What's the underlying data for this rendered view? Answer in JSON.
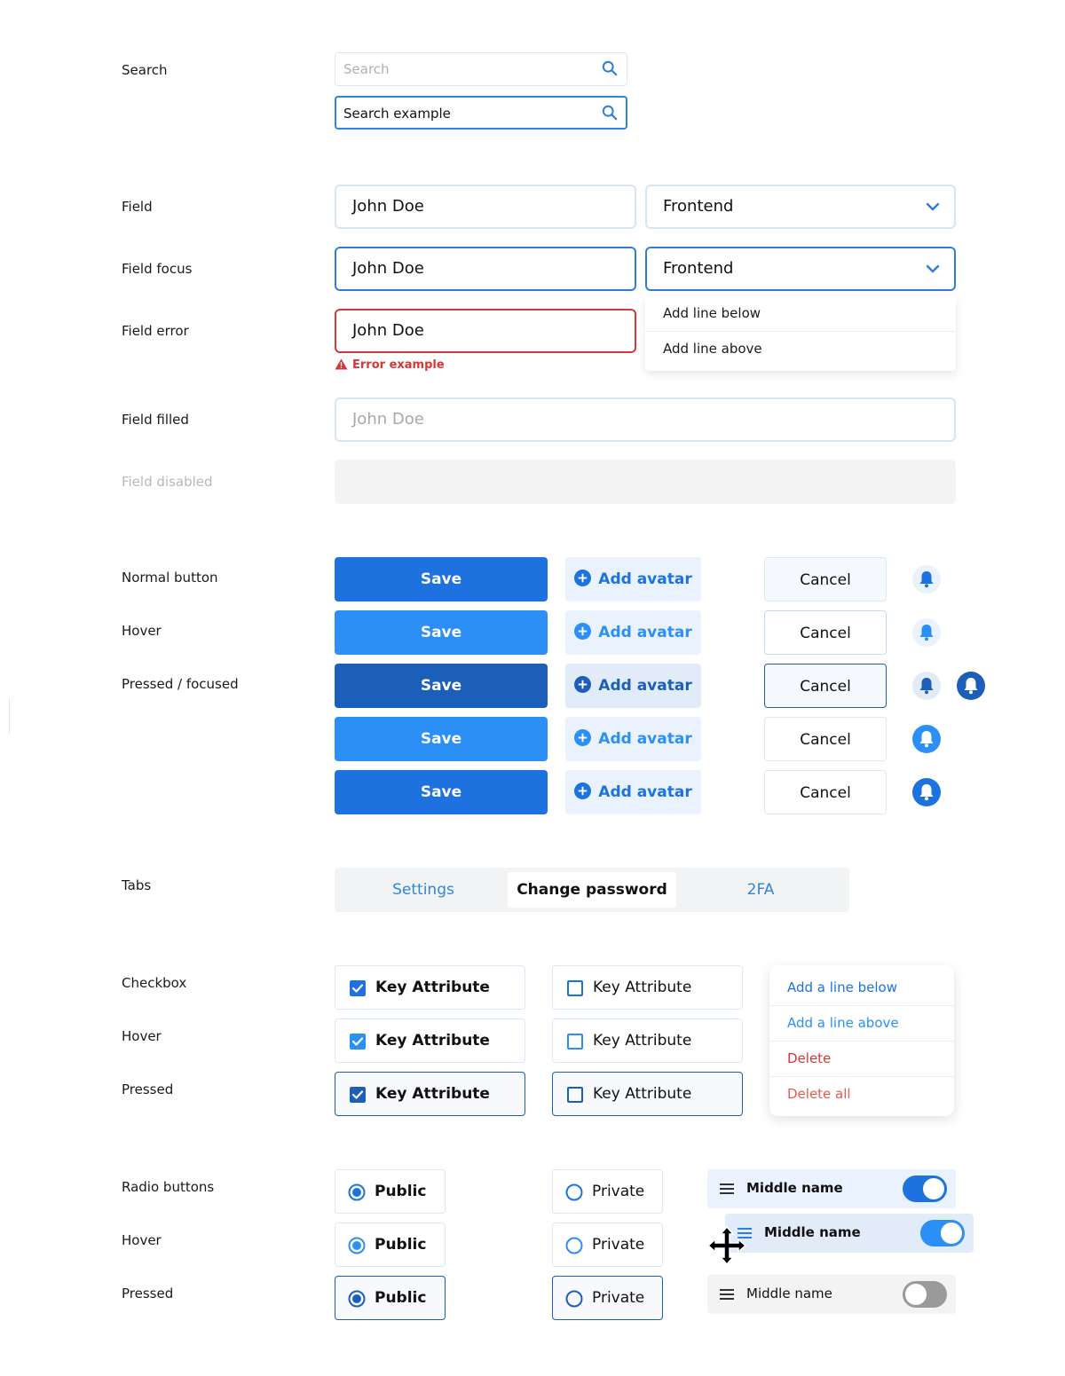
{
  "labels": {
    "search": "Search",
    "field": "Field",
    "field_focus": "Field focus",
    "field_error": "Field error",
    "field_filled": "Field filled",
    "field_disabled": "Field disabled",
    "normal_button": "Normal button",
    "hover": "Hover",
    "pressed_focused": "Pressed / focused",
    "tabs": "Tabs",
    "checkbox": "Checkbox",
    "checkbox_hover": "Hover",
    "checkbox_pressed": "Pressed",
    "radio_buttons": "Radio buttons",
    "radio_hover": "Hover",
    "radio_pressed": "Pressed"
  },
  "search": {
    "placeholder": "Search",
    "value": "Search example"
  },
  "fields": {
    "name_value": "John Doe",
    "select_value": "Frontend",
    "error_message": "Error example",
    "filled_value": "John Doe"
  },
  "dropdown": {
    "options": [
      "Add line below",
      "Add line above"
    ]
  },
  "buttons": {
    "save": "Save",
    "add_avatar": "Add avatar",
    "cancel": "Cancel"
  },
  "tabs": {
    "items": [
      "Settings",
      "Change password",
      "2FA"
    ],
    "active": "Change password"
  },
  "checkbox": {
    "label": "Key Attribute"
  },
  "context_menu": {
    "items": [
      "Add a line below",
      "Add a line above",
      "Delete",
      "Delete all"
    ]
  },
  "radio": {
    "public": "Public",
    "private": "Private"
  },
  "toggles": {
    "label": "Middle name",
    "states": [
      true,
      true,
      false
    ]
  },
  "colors": {
    "primary": "#1d72e0",
    "primary_hover": "#2c8ff5",
    "primary_pressed": "#1c5fb8",
    "error": "#d43838",
    "link": "#2f86d9"
  },
  "icons": [
    "search-icon",
    "chevron-down-icon",
    "warning-icon",
    "plus-circle-icon",
    "bell-icon",
    "check-icon",
    "drag-handle-icon",
    "move-cursor-icon"
  ]
}
